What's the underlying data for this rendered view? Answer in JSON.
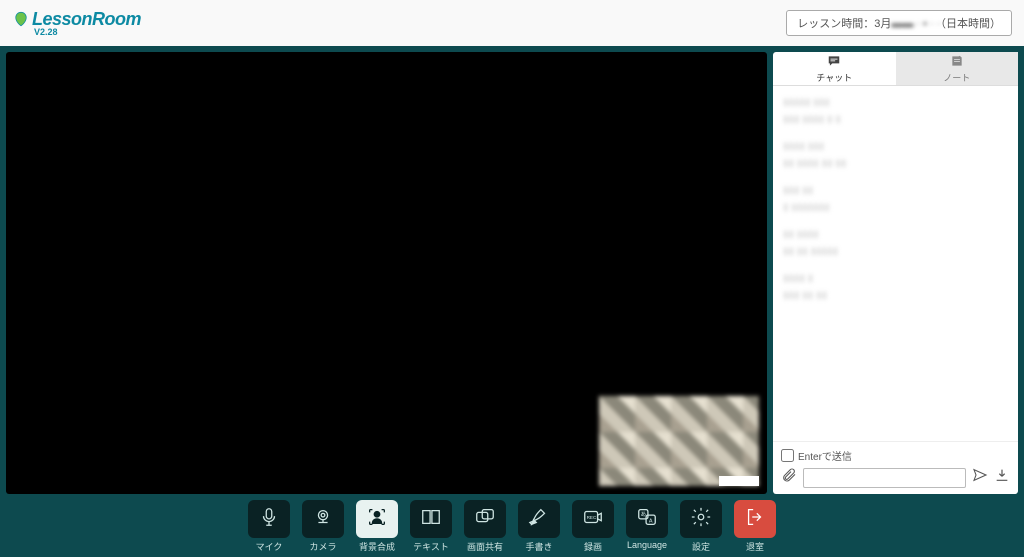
{
  "header": {
    "logo_text": "LessonRoom",
    "version": "V2.28",
    "lesson_time_prefix": "レッスン時間：3月",
    "lesson_time_blur": "▬▬ · ▪ · ·",
    "lesson_time_suffix": "（日本時間）"
  },
  "side": {
    "tabs": {
      "chat": "チャット",
      "note": "ノート"
    },
    "chat_log": [
      {
        "meta": "▮▮▮▮▮ ▮▮▮",
        "text": "▮▮▮ ▮▮▮▮ ▮ ▮"
      },
      {
        "meta": "▮▮▮▮ ▮▮▮",
        "text": "▮▮ ▮▮▮▮ ▮▮ ▮▮"
      },
      {
        "meta": "▮▮▮ ▮▮",
        "text": "▮ ▮▮▮▮▮▮▮"
      },
      {
        "meta": "▮▮ ▮▮▮▮",
        "text": "▮▮ ▮▮ ▮▮▮▮▮"
      },
      {
        "meta": "▮▮▮▮ ▮",
        "text": "▮▮▮ ▮▮ ▮▮"
      }
    ],
    "enter_to_send": "Enterで送信",
    "input_placeholder": ""
  },
  "toolbar": {
    "mic": "マイク",
    "camera": "カメラ",
    "background": "背景合成",
    "text": "テキスト",
    "screenshare": "画面共有",
    "handwriting": "手書き",
    "record": "録画",
    "language": "Language",
    "settings": "設定",
    "exit": "退室"
  }
}
